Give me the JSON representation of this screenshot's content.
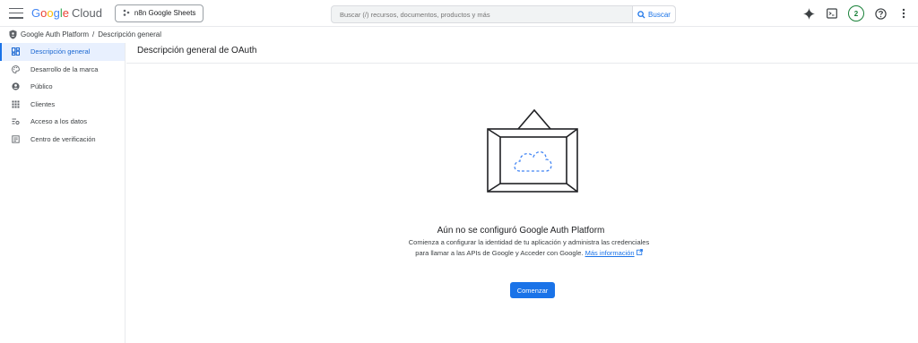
{
  "header": {
    "logo_google": "Google",
    "logo_cloud": "Cloud",
    "project_name": "n8n Google Sheets",
    "search_placeholder": "Buscar (/) recursos, documentos, productos y más",
    "search_button": "Buscar",
    "notifications_count": "2"
  },
  "breadcrumb": {
    "root": "Google Auth Platform",
    "separator": "/",
    "current": "Descripción general"
  },
  "sidebar": {
    "items": [
      {
        "label": "Descripción general",
        "icon": "dashboard-icon"
      },
      {
        "label": "Desarrollo de la marca",
        "icon": "palette-icon"
      },
      {
        "label": "Público",
        "icon": "person-icon"
      },
      {
        "label": "Clientes",
        "icon": "grid-icon"
      },
      {
        "label": "Acceso a los datos",
        "icon": "data-access-icon"
      },
      {
        "label": "Centro de verificación",
        "icon": "verification-icon"
      }
    ]
  },
  "main": {
    "title": "Descripción general de OAuth",
    "empty_title": "Aún no se configuró Google Auth Platform",
    "empty_desc": "Comienza a configurar la identidad de tu aplicación y administra las credenciales para llamar a las APIs de Google y Acceder con Google.",
    "more_info": "Más información",
    "start_button": "Comenzar"
  },
  "colors": {
    "accent": "#1a73e8",
    "active_bg": "#e8f0fe",
    "badge": "#188038"
  }
}
